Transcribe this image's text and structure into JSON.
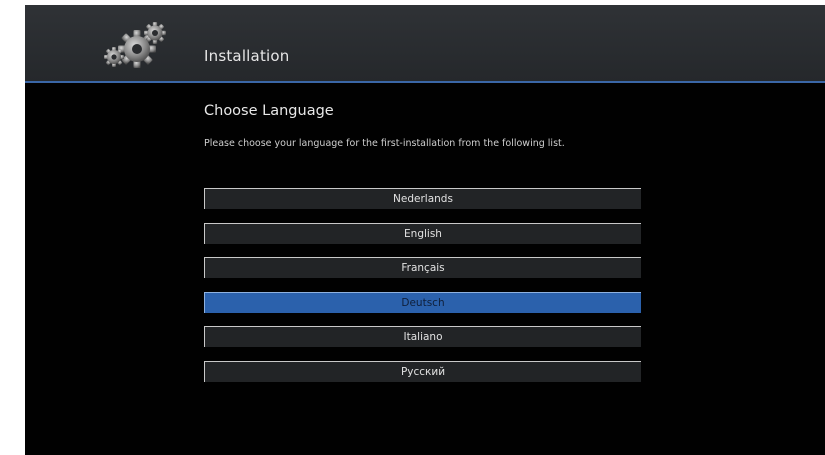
{
  "header": {
    "title": "Installation",
    "logo_icon": "gears-icon"
  },
  "main": {
    "section_title": "Choose Language",
    "description": "Please choose your language for the first-installation from the following list."
  },
  "languages": [
    {
      "label": "Nederlands",
      "selected": false
    },
    {
      "label": "English",
      "selected": false
    },
    {
      "label": "Français",
      "selected": false
    },
    {
      "label": "Deutsch",
      "selected": true
    },
    {
      "label": "Italiano",
      "selected": false
    },
    {
      "label": "Русский",
      "selected": false
    }
  ],
  "colors": {
    "accent": "#3a66a6",
    "selected": "#2b61ac",
    "background": "#010101",
    "header": "#2f3236"
  }
}
